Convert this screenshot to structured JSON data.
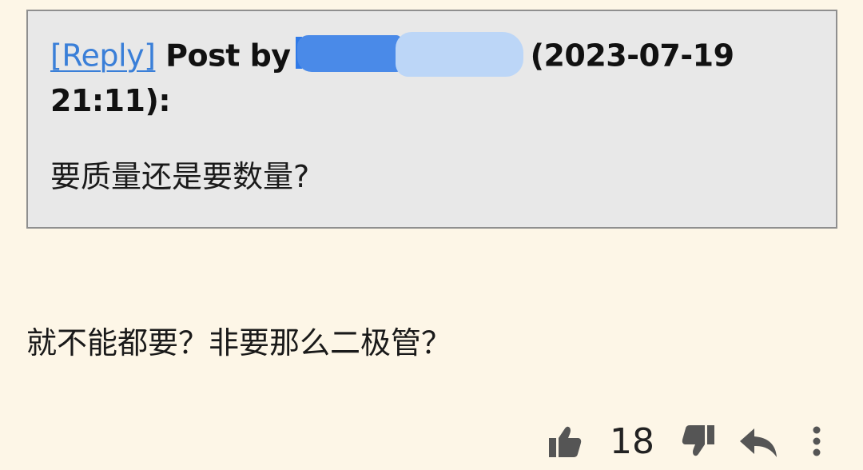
{
  "quote": {
    "reply_label": "[Reply]",
    "post_by_text": "Post by",
    "timestamp_text": "(2023-07-19 21:11):",
    "body": "要质量还是要数量?"
  },
  "post": {
    "body": "就不能都要？非要那么二极管？"
  },
  "actions": {
    "like_count": "18",
    "like_icon": "thumbs-up-icon",
    "dislike_icon": "thumbs-down-icon",
    "reply_icon": "reply-arrow-icon",
    "more_icon": "vertical-ellipsis-icon"
  },
  "colors": {
    "background": "#fdf6e7",
    "quote_background": "#e8e8e8",
    "link": "#3a7fd8",
    "icon": "#555555"
  }
}
